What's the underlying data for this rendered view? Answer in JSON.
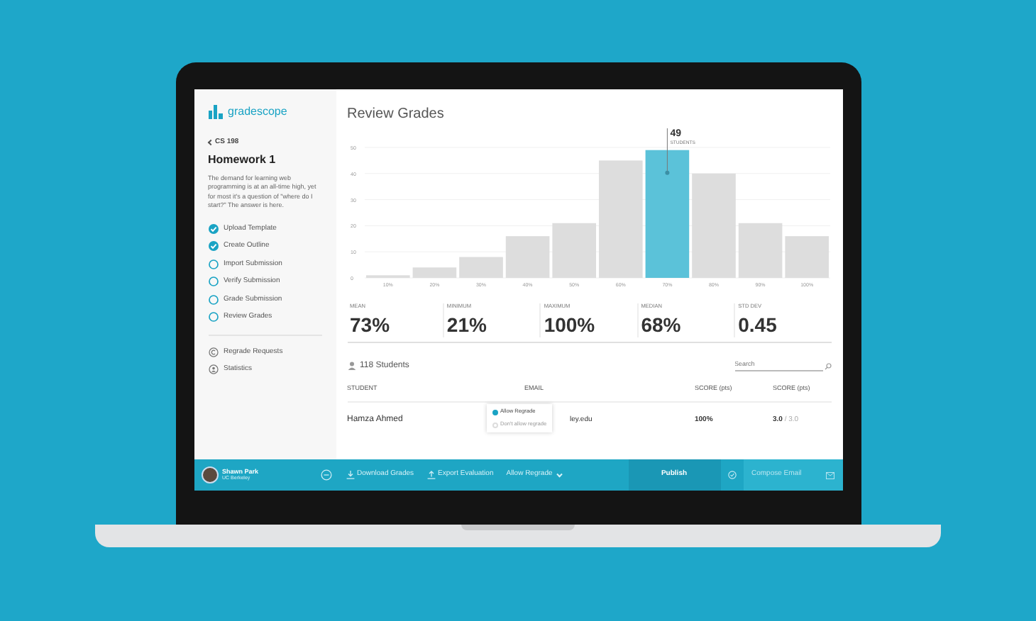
{
  "sidebar": {
    "logo": "gradescope",
    "course": "CS 198",
    "title": "Homework 1",
    "description": "The demand for learning web programming is at an all-time high, yet for most it's a question of \"where do I start?\" The answer is here.",
    "steps": [
      {
        "label": "Upload Template",
        "checked": true
      },
      {
        "label": "Create Outline",
        "checked": true
      },
      {
        "label": "Import Submission",
        "checked": false
      },
      {
        "label": "Verify Submission",
        "checked": false
      },
      {
        "label": "Grade Submission",
        "checked": false
      },
      {
        "label": "Review Grades",
        "checked": false
      }
    ],
    "links": [
      {
        "label": "Regrade Requests",
        "kind": "regrade"
      },
      {
        "label": "Statistics",
        "kind": "stats"
      }
    ]
  },
  "page_title": "Review Grades",
  "chart_data": {
    "type": "bar",
    "categories": [
      "10%",
      "20%",
      "30%",
      "40%",
      "50%",
      "60%",
      "70%",
      "80%",
      "90%",
      "100%"
    ],
    "series": [
      {
        "color": "#dddddd",
        "values": [
          1,
          4,
          8,
          16,
          21,
          45,
          null,
          40,
          21,
          16
        ]
      },
      {
        "color": "#5bc2d9",
        "values": [
          null,
          null,
          null,
          null,
          null,
          null,
          49,
          null,
          null,
          null
        ]
      }
    ],
    "stacked": true,
    "ylim": [
      0,
      50
    ],
    "yticks": [
      0,
      10,
      20,
      30,
      40,
      50
    ],
    "grid": true,
    "annotations": [
      {
        "x": "70%",
        "y": 49,
        "text": "49"
      },
      {
        "x": "70%",
        "y": 49,
        "text": "STUDENTS"
      }
    ]
  },
  "stats": [
    {
      "label": "MEAN",
      "value": "73%"
    },
    {
      "label": "MINIMUM",
      "value": "21%"
    },
    {
      "label": "MAXIMUM",
      "value": "100%"
    },
    {
      "label": "MEDIAN",
      "value": "68%"
    },
    {
      "label": "STD DEV",
      "value": "0.45"
    }
  ],
  "students": {
    "count": "118 Students",
    "search": {
      "placeholder": "Search"
    },
    "columns": [
      "STUDENT",
      "EMAIL",
      "SCORE (pts)",
      "SCORE (pts)"
    ],
    "rows": [
      {
        "student": "Hamza Ahmed",
        "email": "ley.edu",
        "percent": "100%",
        "score": "3.0",
        "max": "/ 3.0"
      }
    ]
  },
  "regrade_menu": [
    {
      "label": "Allow Regrade",
      "selected": true
    },
    {
      "label": "Don't allow regrade",
      "selected": false
    }
  ],
  "bottom_bar": {
    "user": {
      "name": "Shawn Park",
      "school": "UC Berkeley"
    },
    "actions": [
      {
        "label": "Download Grades",
        "kind": "download"
      },
      {
        "label": "Export Evaluation",
        "kind": "export"
      },
      {
        "label": "Allow Regrade",
        "kind": "dropdown"
      }
    ],
    "publish": "Publish",
    "compose": "Compose Email"
  }
}
